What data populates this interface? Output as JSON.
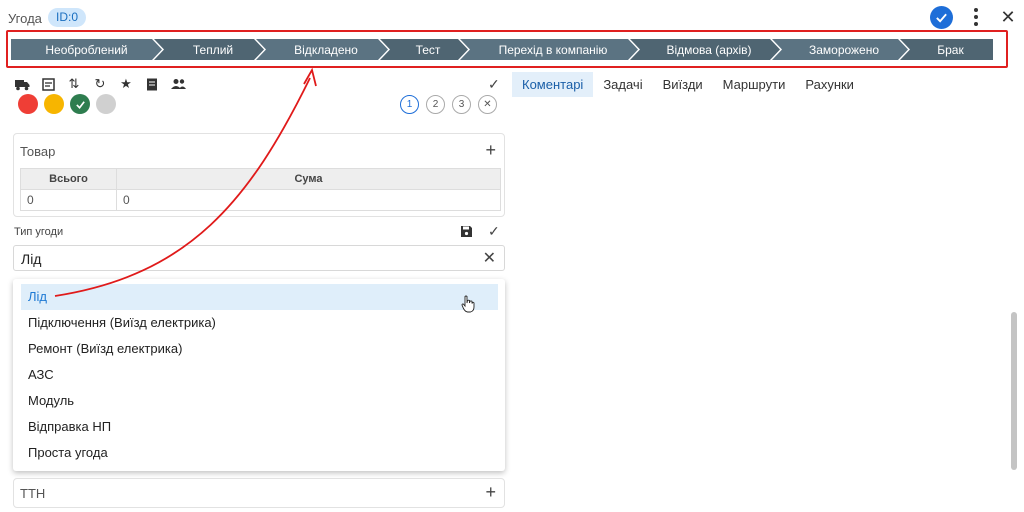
{
  "header": {
    "title": "Угода",
    "id_badge": "ID:0"
  },
  "stages": [
    "Необроблений",
    "Теплий",
    "Відкладено",
    "Тест",
    "Перехід в компанію",
    "Відмова (архів)",
    "Заморожено",
    "Брак"
  ],
  "colors": {
    "stage_bg": "#4f6572",
    "highlight_frame": "#e02020",
    "accent": "#1e6ed8"
  },
  "toolbar_icons": [
    "truck-icon",
    "note-icon",
    "swap-icon",
    "refresh-icon",
    "star-icon",
    "document-icon",
    "people-icon"
  ],
  "color_dots": [
    "#ef3e36",
    "#f7b500",
    "#2e7d4f",
    "#d0d0d0"
  ],
  "steps": [
    "1",
    "2",
    "3"
  ],
  "tabs": [
    "Коментарі",
    "Задачі",
    "Виїзди",
    "Маршрути",
    "Рахунки"
  ],
  "product": {
    "title": "Товар",
    "columns": [
      "Всього",
      "Сума"
    ],
    "rows": [
      [
        "0",
        "0"
      ]
    ]
  },
  "deal_type": {
    "label": "Тип угоди",
    "value": "Лід",
    "options": [
      "Лід",
      "Підключення (Виїзд електрика)",
      "Ремонт (Виїзд електрика)",
      "АЗС",
      "Модуль",
      "Відправка НП",
      "Проста угода"
    ],
    "highlighted_index": 0
  },
  "ttn": {
    "title": "ТТН"
  }
}
